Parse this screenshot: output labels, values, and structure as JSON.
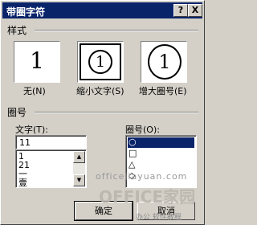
{
  "dialog": {
    "title": "带圈字符",
    "help_button": "?",
    "close_button": "X"
  },
  "style_section": {
    "label": "样式",
    "options": [
      {
        "label": "无(N)",
        "glyph": "1"
      },
      {
        "label": "缩小文字(S)",
        "glyph": "1"
      },
      {
        "label": "增大圈号(E)",
        "glyph": "1"
      }
    ],
    "selected_index": 1
  },
  "circle_section": {
    "label": "圈号",
    "text_field": {
      "label": "文字(T):",
      "value": "11",
      "items": [
        "1",
        "21",
        "一",
        "壹"
      ]
    },
    "enclosure": {
      "label": "圈号(O):",
      "items": [
        "○",
        "□",
        "△",
        "◇"
      ],
      "selected_index": 0
    }
  },
  "buttons": {
    "ok": "确定",
    "cancel": "取消"
  },
  "watermark": {
    "url": "officejiayuan.com",
    "brand": "OFFICE家园",
    "tagline": "办公 软件教程"
  }
}
